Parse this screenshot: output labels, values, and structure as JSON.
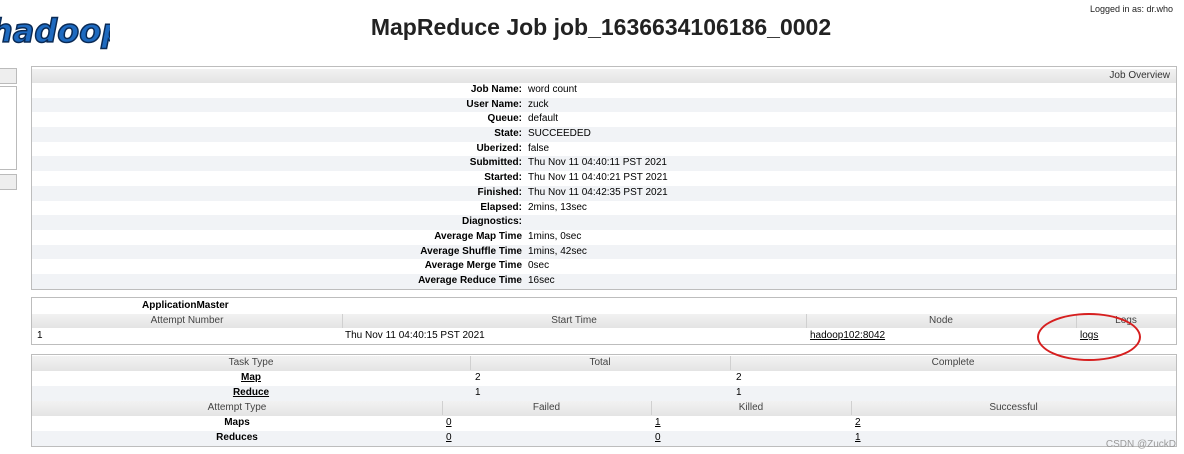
{
  "header": {
    "logo_text": "hadoop",
    "title": "MapReduce Job job_1636634106186_0002",
    "logged_in": "Logged in as: dr.who"
  },
  "overview": {
    "caption": "Job Overview",
    "rows": [
      {
        "key": "Job Name:",
        "value": "word count"
      },
      {
        "key": "User Name:",
        "value": "zuck"
      },
      {
        "key": "Queue:",
        "value": "default"
      },
      {
        "key": "State:",
        "value": "SUCCEEDED"
      },
      {
        "key": "Uberized:",
        "value": "false"
      },
      {
        "key": "Submitted:",
        "value": "Thu Nov 11 04:40:11 PST 2021"
      },
      {
        "key": "Started:",
        "value": "Thu Nov 11 04:40:21 PST 2021"
      },
      {
        "key": "Finished:",
        "value": "Thu Nov 11 04:42:35 PST 2021"
      },
      {
        "key": "Elapsed:",
        "value": "2mins, 13sec"
      },
      {
        "key": "Diagnostics:",
        "value": ""
      },
      {
        "key": "Average Map Time",
        "value": "1mins, 0sec"
      },
      {
        "key": "Average Shuffle Time",
        "value": "1mins, 42sec"
      },
      {
        "key": "Average Merge Time",
        "value": "0sec"
      },
      {
        "key": "Average Reduce Time",
        "value": "16sec"
      }
    ]
  },
  "app_master": {
    "title": "ApplicationMaster",
    "headers": [
      "Attempt Number",
      "Start Time",
      "Node",
      "Logs"
    ],
    "row": {
      "attempt": "1",
      "start_time": "Thu Nov 11 04:40:15 PST 2021",
      "node": "hadoop102:8042",
      "logs": "logs"
    }
  },
  "tasks": {
    "headers": [
      "Task Type",
      "Total",
      "Complete"
    ],
    "rows": [
      {
        "type": "Map",
        "total": "2",
        "complete": "2"
      },
      {
        "type": "Reduce",
        "total": "1",
        "complete": "1"
      }
    ]
  },
  "attempts": {
    "headers": [
      "Attempt Type",
      "Failed",
      "Killed",
      "Successful"
    ],
    "rows": [
      {
        "type": "Maps",
        "failed": "0",
        "killed": "1",
        "successful": "2"
      },
      {
        "type": "Reduces",
        "failed": "0",
        "killed": "0",
        "successful": "1"
      }
    ]
  },
  "watermark": "CSDN @ZuckD"
}
